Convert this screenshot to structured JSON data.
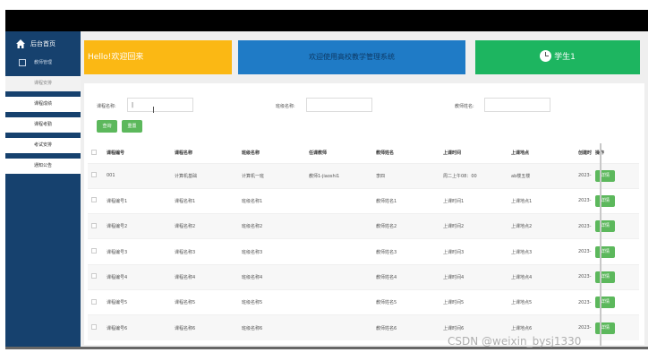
{
  "sidebar": {
    "home_label": "后台首页",
    "section_label": "教师管理",
    "items": [
      {
        "label": "课程安排",
        "active": true
      },
      {
        "label": "课程成绩",
        "active": false
      },
      {
        "label": "课程考勤",
        "active": false
      },
      {
        "label": "考试安排",
        "active": false
      },
      {
        "label": "通知公告",
        "active": false
      }
    ]
  },
  "banners": {
    "hello": "Hello!欢迎回来",
    "welcome": "欢迎使用高校教学管理系统",
    "student": "学生1"
  },
  "search": {
    "course_name_label": "课程名称:",
    "course_name_value": "|",
    "class_name_label": "班级名称:",
    "class_name_value": "",
    "teacher_name_label": "教师姓名:",
    "teacher_name_value": "",
    "query_button": "查询",
    "reset_button": "重置"
  },
  "table": {
    "headers": [
      "课程编号",
      "课程名称",
      "班级名称",
      "任课教师",
      "教师姓名",
      "上课时间",
      "上课地点",
      "创建时间",
      "操作"
    ],
    "rows": [
      [
        "001",
        "计算机基础",
        "计算机一班",
        "教师1-jiaoshi1",
        "李四",
        "周二上午08：00",
        "ab楼五楼",
        "2023-",
        "详情"
      ],
      [
        "课程编号1",
        "课程名称1",
        "班级名称1",
        "",
        "教师姓名1",
        "上课时间1",
        "上课地点1",
        "2023-",
        "详情"
      ],
      [
        "课程编号2",
        "课程名称2",
        "班级名称2",
        "",
        "教师姓名2",
        "上课时间2",
        "上课地点2",
        "2023-",
        "详情"
      ],
      [
        "课程编号3",
        "课程名称3",
        "班级名称3",
        "",
        "教师姓名3",
        "上课时间3",
        "上课地点3",
        "2023-",
        "详情"
      ],
      [
        "课程编号4",
        "课程名称4",
        "班级名称4",
        "",
        "教师姓名4",
        "上课时间4",
        "上课地点4",
        "2023-",
        "详情"
      ],
      [
        "课程编号5",
        "课程名称5",
        "班级名称5",
        "",
        "教师姓名5",
        "上课时间5",
        "上课地点5",
        "2023-",
        "详情"
      ],
      [
        "课程编号6",
        "课程名称6",
        "班级名称6",
        "",
        "教师姓名6",
        "上课时间6",
        "上课地点6",
        "2023-",
        "详情"
      ]
    ]
  },
  "watermark": "CSDN @weixin_bysj1330",
  "colors": {
    "sidebar_bg": "#16416e",
    "hello_bg": "#fbb814",
    "welcome_bg": "#1f7bc6",
    "student_bg": "#1db560",
    "button_green": "#5cb85c"
  },
  "icons": {
    "home": "home-icon",
    "management": "edit-icon",
    "student": "clock-icon"
  }
}
